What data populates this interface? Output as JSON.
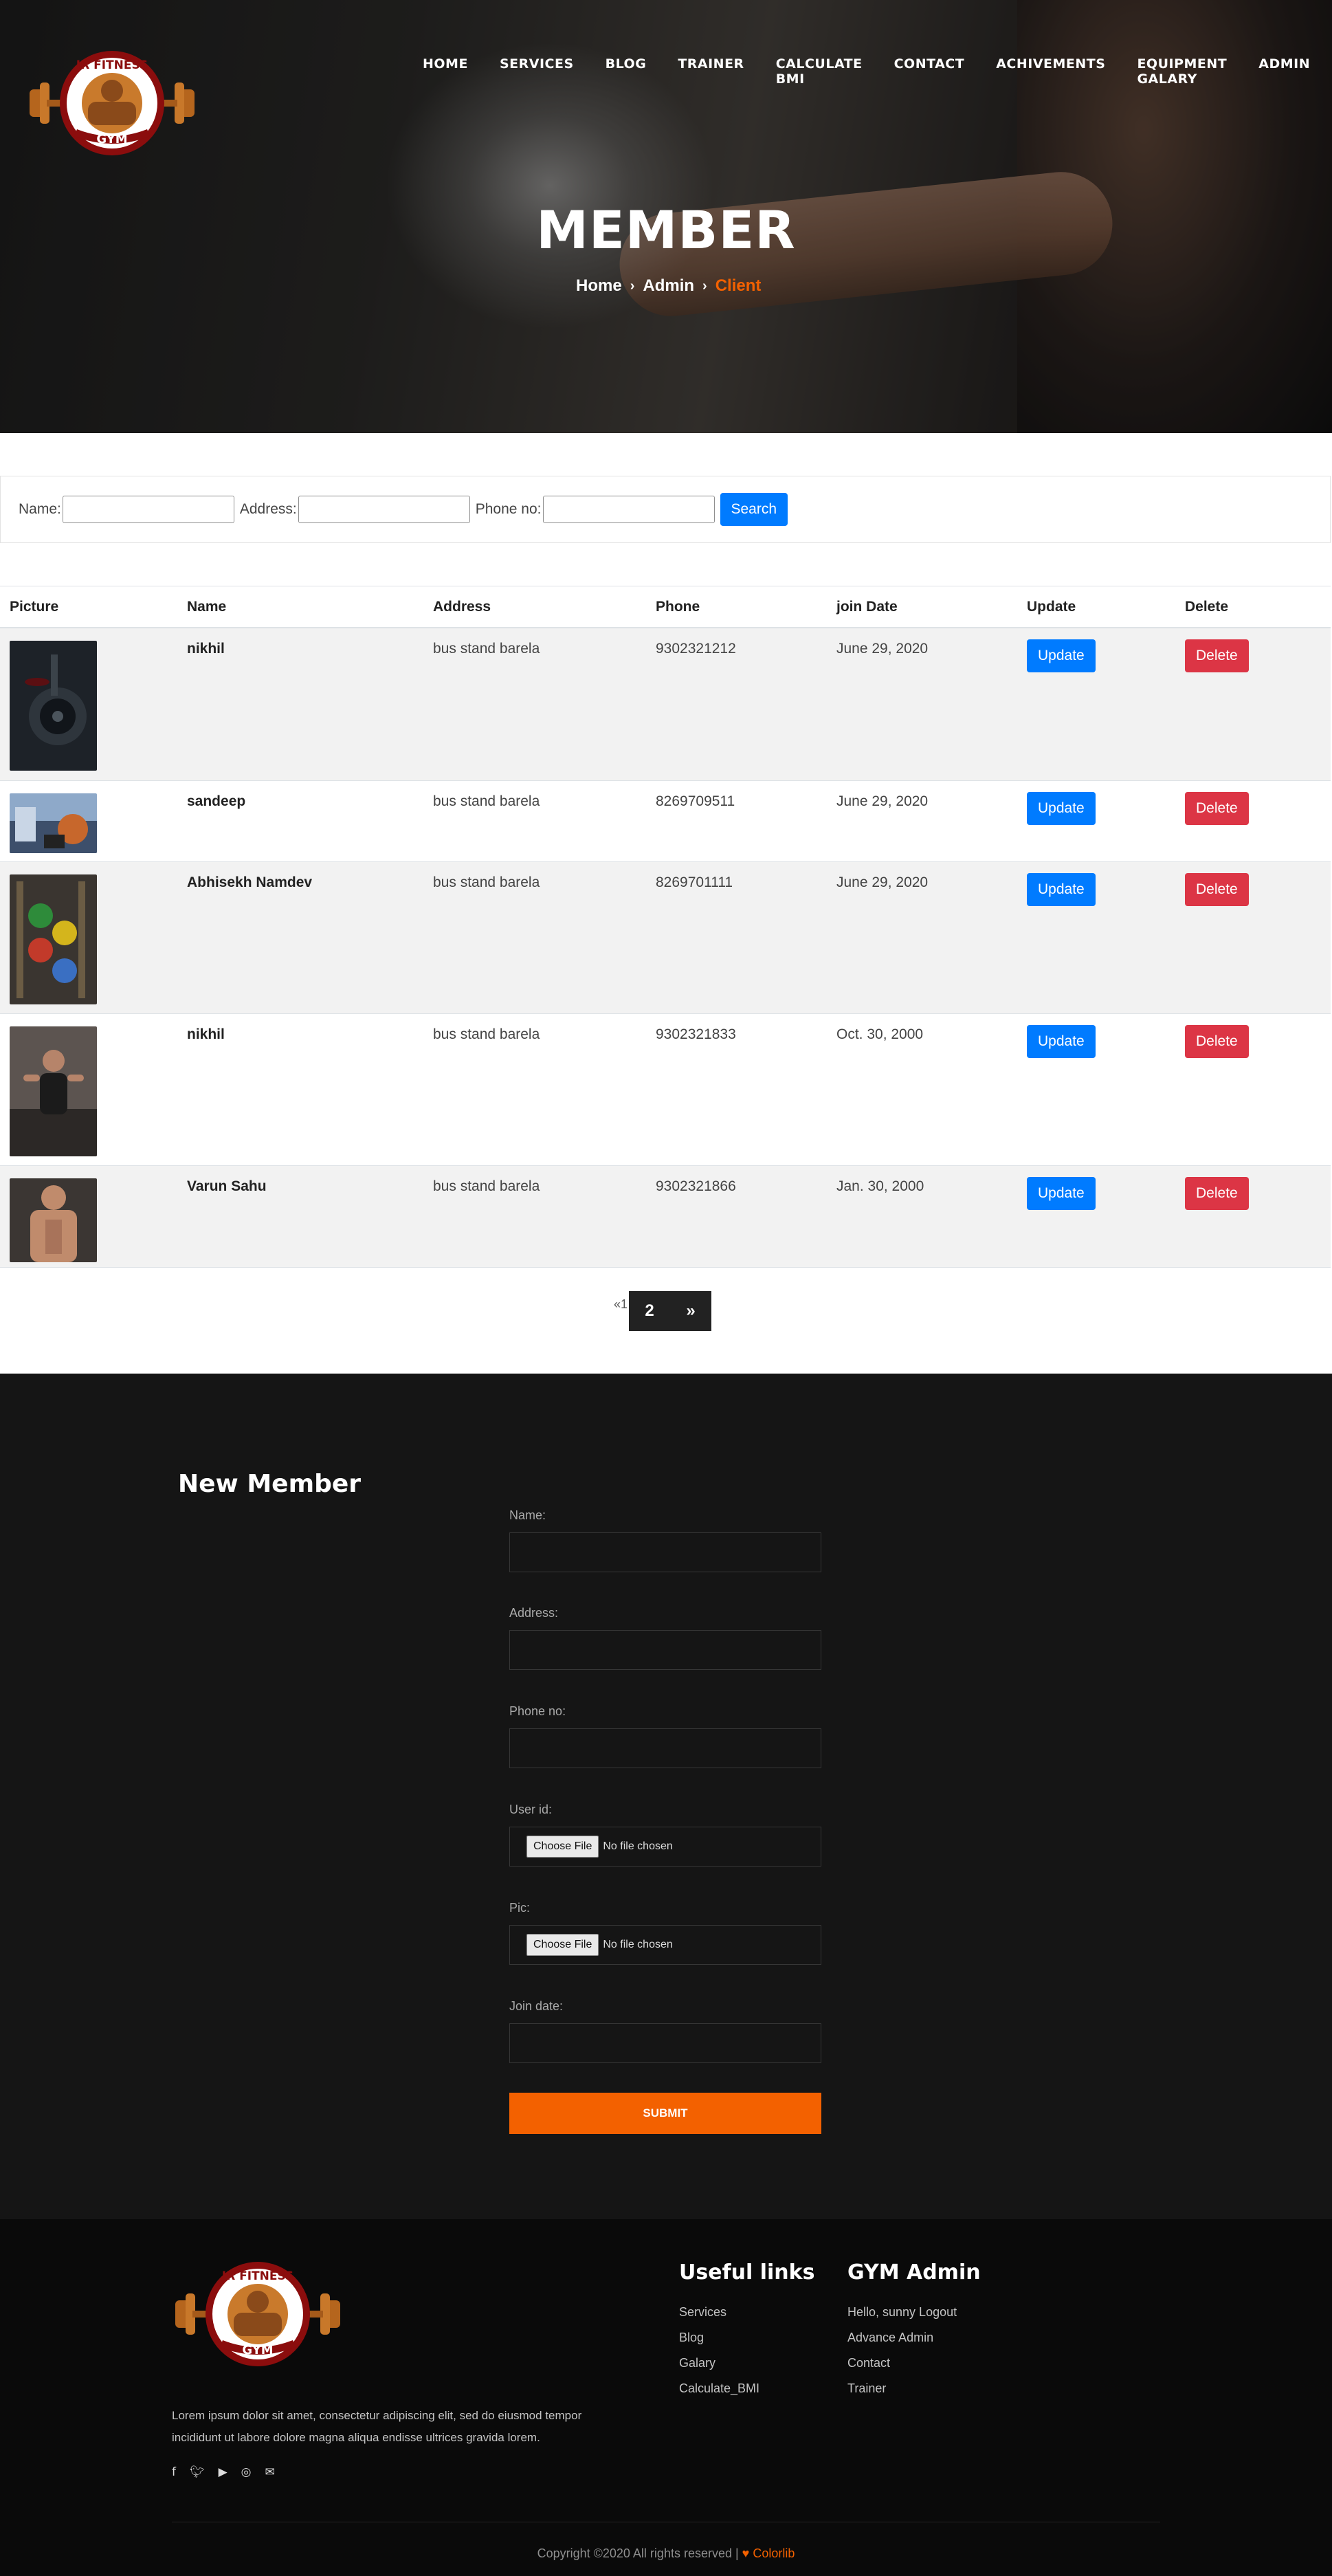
{
  "nav": {
    "items": [
      "HOME",
      "SERVICES",
      "BLOG",
      "TRAINER",
      "CALCULATE BMI",
      "CONTACT",
      "ACHIVEMENTS",
      "EQUIPMENT GALARY",
      "ADMIN"
    ]
  },
  "logo": {
    "line1": "JR FITNESS",
    "line2": "GYM"
  },
  "hero": {
    "title": "MEMBER",
    "breadcrumb": [
      "Home",
      "Admin",
      "Client"
    ]
  },
  "search": {
    "name_label": "Name:",
    "address_label": "Address:",
    "phone_label": "Phone no:",
    "button": "Search"
  },
  "table": {
    "headers": [
      "Picture",
      "Name",
      "Address",
      "Phone",
      "join Date",
      "Update",
      "Delete"
    ],
    "update_label": "Update",
    "delete_label": "Delete",
    "rows": [
      {
        "name": "nikhil",
        "address": "bus stand barela",
        "phone": "9302321212",
        "join_date": "June 29, 2020",
        "pic": "weight-plates-photo"
      },
      {
        "name": "sandeep",
        "address": "bus stand barela",
        "phone": "8269709511",
        "join_date": "June 29, 2020",
        "pic": "gym-interior-photo"
      },
      {
        "name": "Abhisekh Namdev",
        "address": "bus stand barela",
        "phone": "8269701111",
        "join_date": "June 29, 2020",
        "pic": "colored-plates-photo"
      },
      {
        "name": "nikhil",
        "address": "bus stand barela",
        "phone": "9302321833",
        "join_date": "Oct. 30, 2000",
        "pic": "man-workout-photo"
      },
      {
        "name": "Varun Sahu",
        "address": "bus stand barela",
        "phone": "9302321866",
        "join_date": "Jan. 30, 2000",
        "pic": "muscular-man-photo"
      }
    ]
  },
  "pagination": {
    "prev": "«1",
    "current": "2",
    "next": "»"
  },
  "form": {
    "title": "New Member",
    "fields": [
      "Name:",
      "Address:",
      "Phone no:",
      "User id:",
      "Pic:",
      "Join date:"
    ],
    "file_button": "Choose File",
    "file_status": "No file chosen",
    "submit": "SUBMIT"
  },
  "footer": {
    "text": "Lorem ipsum dolor sit amet, consectetur adipiscing elit, sed do eiusmod tempor incididunt ut labore dolore magna aliqua endisse ultrices gravida lorem.",
    "useful_title": "Useful links",
    "useful_links": [
      "Services",
      "Blog",
      "Galary",
      "Calculate_BMI"
    ],
    "admin_title": "GYM Admin",
    "admin_links": [
      "Hello, sunny Logout",
      "Advance Admin",
      "Contact",
      "Trainer"
    ],
    "social": [
      "facebook-icon",
      "twitter-icon",
      "youtube-icon",
      "instagram-icon",
      "mail-icon"
    ],
    "copyright": "Copyright ©2020 All rights reserved | ",
    "heart": "♥",
    "brand": "Colorlib"
  },
  "colors": {
    "accent": "#f36100",
    "primary": "#007bff",
    "danger": "#dc3545"
  }
}
